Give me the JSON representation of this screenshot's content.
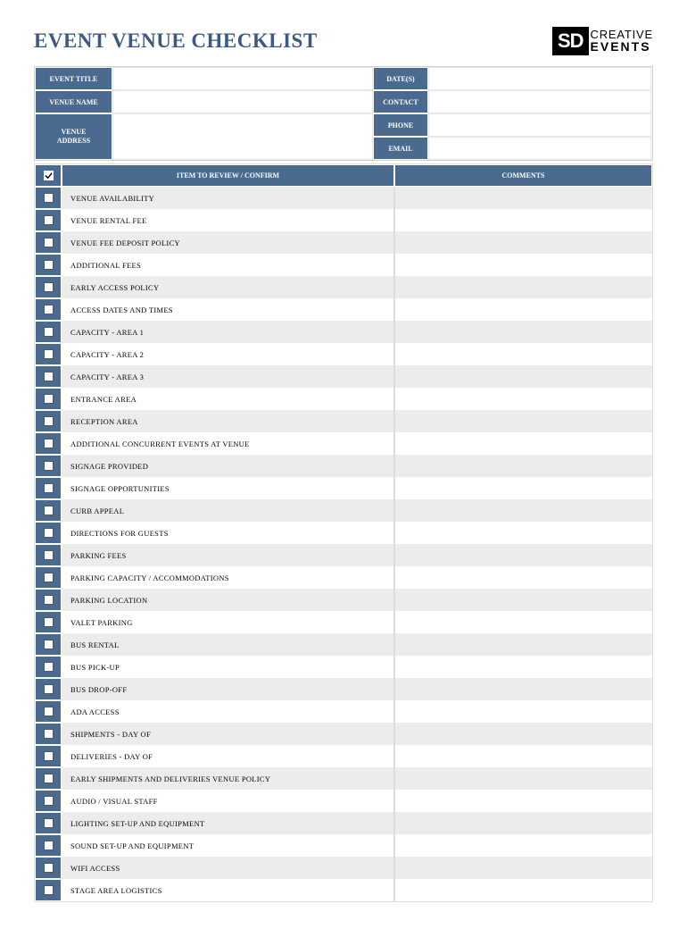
{
  "title": "EVENT VENUE CHECKLIST",
  "logo": {
    "sd": "SD",
    "line1": "CREATIVE",
    "line2": "EVENTS"
  },
  "info": {
    "event_title_label": "EVENT TITLE",
    "event_title_value": "",
    "dates_label": "DATE(S)",
    "dates_value": "",
    "venue_name_label": "VENUE NAME",
    "venue_name_value": "",
    "contact_label": "CONTACT",
    "contact_value": "",
    "venue_address_label1": "VENUE",
    "venue_address_label2": "ADDRESS",
    "venue_address_value": "",
    "phone_label": "PHONE",
    "phone_value": "",
    "email_label": "EMAIL",
    "email_value": ""
  },
  "table": {
    "header_item": "ITEM TO REVIEW / CONFIRM",
    "header_comments": "COMMENTS",
    "rows": [
      {
        "item": "VENUE AVAILABILITY",
        "comment": ""
      },
      {
        "item": "VENUE RENTAL FEE",
        "comment": ""
      },
      {
        "item": "VENUE FEE DEPOSIT POLICY",
        "comment": ""
      },
      {
        "item": "ADDITIONAL FEES",
        "comment": ""
      },
      {
        "item": "EARLY ACCESS POLICY",
        "comment": ""
      },
      {
        "item": "ACCESS DATES AND TIMES",
        "comment": ""
      },
      {
        "item": "CAPACITY - AREA 1",
        "comment": ""
      },
      {
        "item": "CAPACITY - AREA 2",
        "comment": ""
      },
      {
        "item": "CAPACITY - AREA 3",
        "comment": ""
      },
      {
        "item": "ENTRANCE AREA",
        "comment": ""
      },
      {
        "item": "RECEPTION AREA",
        "comment": ""
      },
      {
        "item": "ADDITIONAL CONCURRENT EVENTS AT VENUE",
        "comment": ""
      },
      {
        "item": "SIGNAGE PROVIDED",
        "comment": ""
      },
      {
        "item": "SIGNAGE OPPORTUNITIES",
        "comment": ""
      },
      {
        "item": "CURB APPEAL",
        "comment": ""
      },
      {
        "item": "DIRECTIONS FOR GUESTS",
        "comment": ""
      },
      {
        "item": "PARKING FEES",
        "comment": ""
      },
      {
        "item": "PARKING CAPACITY / ACCOMMODATIONS",
        "comment": ""
      },
      {
        "item": "PARKING LOCATION",
        "comment": ""
      },
      {
        "item": "VALET PARKING",
        "comment": ""
      },
      {
        "item": "BUS RENTAL",
        "comment": ""
      },
      {
        "item": "BUS PICK-UP",
        "comment": ""
      },
      {
        "item": "BUS DROP-OFF",
        "comment": ""
      },
      {
        "item": "ADA ACCESS",
        "comment": ""
      },
      {
        "item": "SHIPMENTS - DAY OF",
        "comment": ""
      },
      {
        "item": "DELIVERIES - DAY OF",
        "comment": ""
      },
      {
        "item": "EARLY SHIPMENTS AND DELIVERIES VENUE POLICY",
        "comment": ""
      },
      {
        "item": "AUDIO / VISUAL STAFF",
        "comment": ""
      },
      {
        "item": "LIGHTING SET-UP AND EQUIPMENT",
        "comment": ""
      },
      {
        "item": "SOUND SET-UP AND EQUIPMENT",
        "comment": ""
      },
      {
        "item": "WIFI ACCESS",
        "comment": ""
      },
      {
        "item": "STAGE AREA LOGISTICS",
        "comment": ""
      }
    ]
  }
}
